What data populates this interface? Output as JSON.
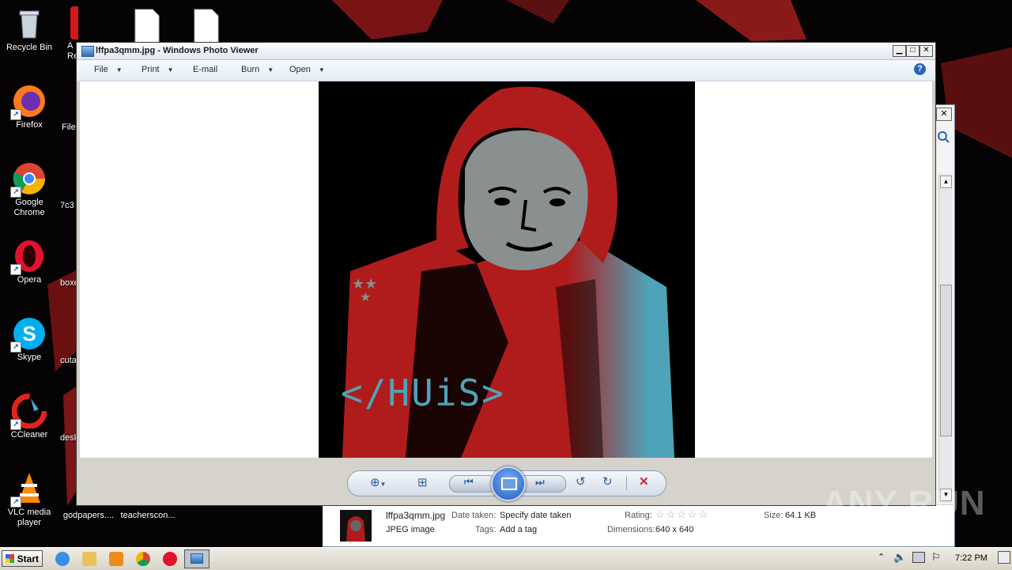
{
  "desktop": {
    "icons": [
      {
        "label": "Recycle Bin",
        "icon": "recycle-bin-icon"
      },
      {
        "label": "Firefox",
        "icon": "firefox-icon"
      },
      {
        "label": "Google Chrome",
        "icon": "chrome-icon"
      },
      {
        "label": "Opera",
        "icon": "opera-icon"
      },
      {
        "label": "Skype",
        "icon": "skype-icon"
      },
      {
        "label": "CCleaner",
        "icon": "ccleaner-icon"
      },
      {
        "label": "VLC media player",
        "icon": "vlc-icon"
      }
    ],
    "partial_icons": [
      {
        "label": "A Re",
        "icon": "acrobat-reader-icon"
      },
      {
        "label": "File",
        "icon": "file-icon"
      },
      {
        "label": "7c3",
        "icon": "file-icon"
      },
      {
        "label": "boxe",
        "icon": "file-icon"
      },
      {
        "label": "cuta",
        "icon": "file-icon"
      },
      {
        "label": "desk",
        "icon": "file-icon"
      },
      {
        "label": "godpapers....",
        "icon": "file-icon"
      },
      {
        "label": "teacherscon...",
        "icon": "file-icon"
      }
    ]
  },
  "photo_viewer": {
    "title": "lffpa3qmm.jpg - Windows Photo Viewer",
    "menu": [
      {
        "label": "File",
        "has_dropdown": true
      },
      {
        "label": "Print",
        "has_dropdown": true
      },
      {
        "label": "E-mail",
        "has_dropdown": false
      },
      {
        "label": "Burn",
        "has_dropdown": true
      },
      {
        "label": "Open",
        "has_dropdown": true
      }
    ],
    "image_text": "</HUiS>",
    "controls": [
      "zoom-icon",
      "actual-size-icon",
      "previous-icon",
      "slideshow-icon",
      "next-icon",
      "rotate-left-icon",
      "rotate-right-icon",
      "delete-icon"
    ]
  },
  "details": {
    "filename": "lffpa3qmm.jpg",
    "filetype": "JPEG image",
    "date_label": "Date taken:",
    "date_value": "Specify date taken",
    "tags_label": "Tags:",
    "tags_value": "Add a tag",
    "rating_label": "Rating:",
    "rating_stars": "☆☆☆☆☆",
    "dimensions_label": "Dimensions:",
    "dimensions_value": "640 x 640",
    "size_label": "Size:",
    "size_value": "64.1 KB"
  },
  "taskbar": {
    "start_label": "Start",
    "clock": "7:22 PM"
  },
  "watermark": "ANY RUN",
  "colors": {
    "hood_red": "#b01c1c",
    "accent_teal": "#4fa3b8",
    "title_blue": "#2b5d9a"
  }
}
